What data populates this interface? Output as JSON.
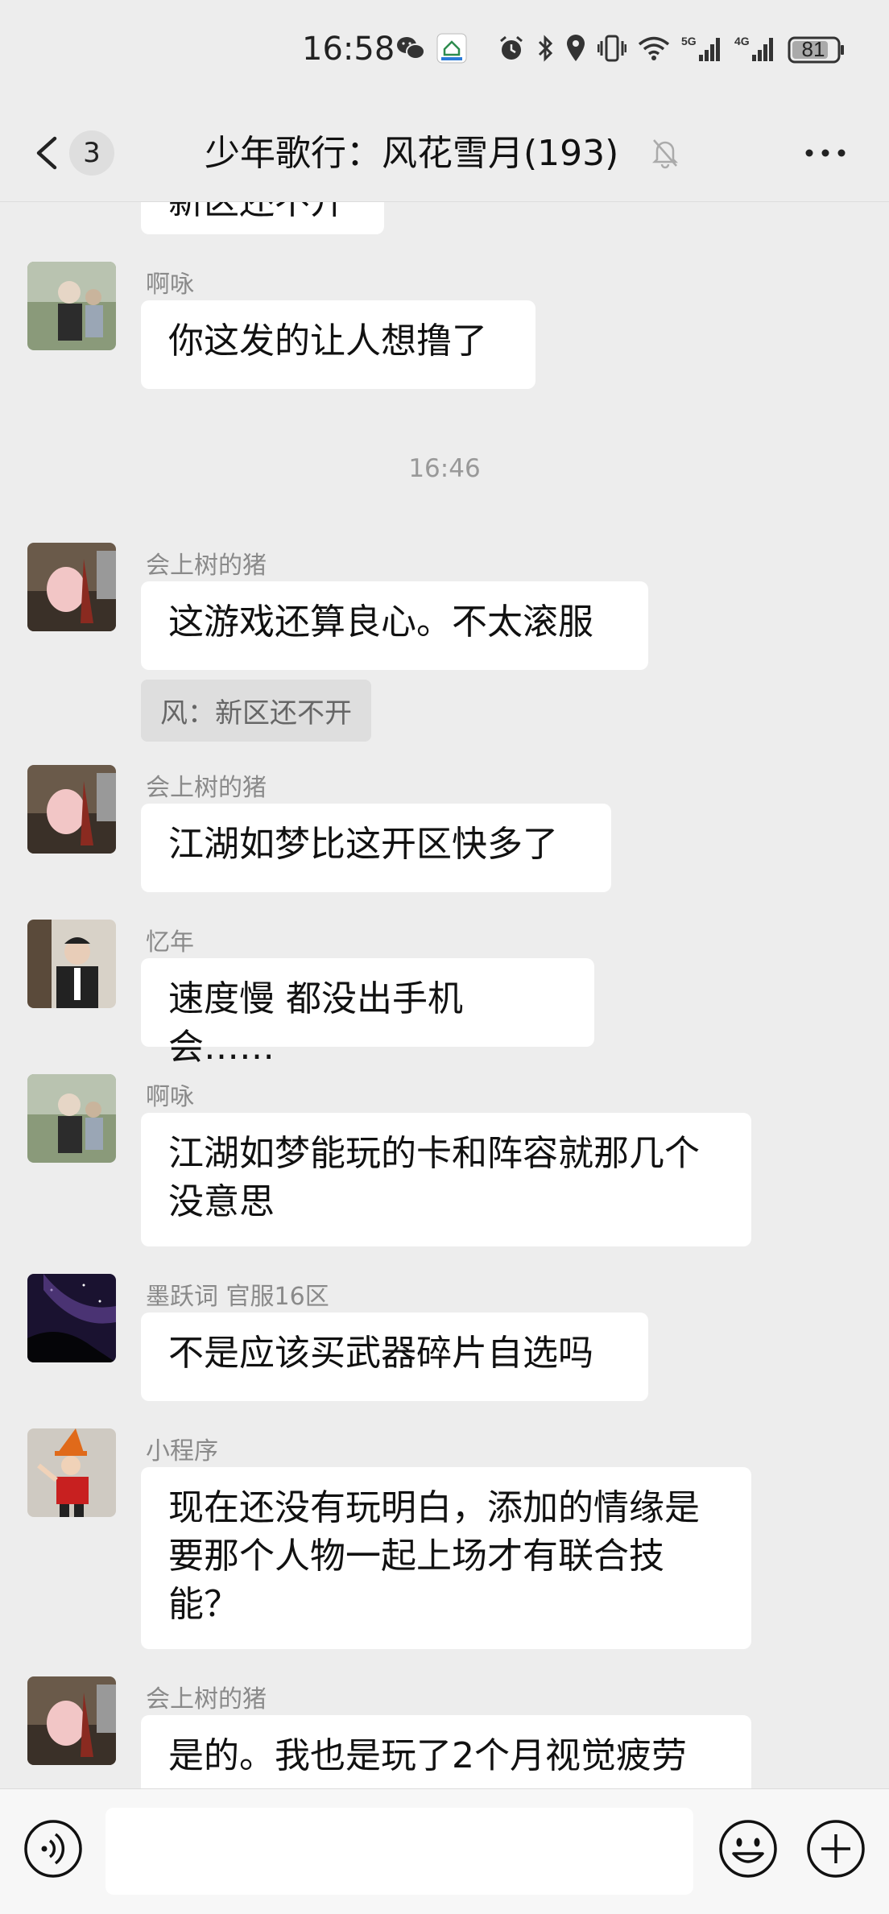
{
  "status_bar": {
    "time": "16:58",
    "battery": "81",
    "network1": "5G",
    "network2": "4G",
    "icons": [
      "wechat-icon",
      "app-icon",
      "alarm-icon",
      "bluetooth-icon",
      "location-icon",
      "vibrate-icon",
      "wifi-icon",
      "signal-icon",
      "battery-icon"
    ]
  },
  "header": {
    "back_count": "3",
    "title": "少年歌行：风花雪月(193)"
  },
  "chat": {
    "top_partial": "新区还不开",
    "timestamp": "16:46",
    "messages": [
      {
        "sender": "啊咏",
        "text": "你这发的让人想撸了"
      },
      {
        "sender": "会上树的猪",
        "text": "这游戏还算良心。不太滚服",
        "quote": "风：新区还不开"
      },
      {
        "sender": "会上树的猪",
        "text": "江湖如梦比这开区快多了"
      },
      {
        "sender": "忆年",
        "text": "速度慢 都没出手机会……"
      },
      {
        "sender": "啊咏",
        "text": "江湖如梦能玩的卡和阵容就那几个没意思"
      },
      {
        "sender": "墨跃词 官服16区",
        "text": "不是应该买武器碎片自选吗"
      },
      {
        "sender": "小程序",
        "text": "现在还没有玩明白，添加的情缘是要那个人物一起上场才有联合技能？"
      },
      {
        "sender": "会上树的猪",
        "text": "是的。我也是玩了2个月视觉疲劳"
      }
    ]
  },
  "input_bar": {
    "placeholder": ""
  },
  "colors": {
    "background": "#ededed",
    "bubble": "#ffffff",
    "quote": "#dedede",
    "name": "#8a8a8a"
  }
}
